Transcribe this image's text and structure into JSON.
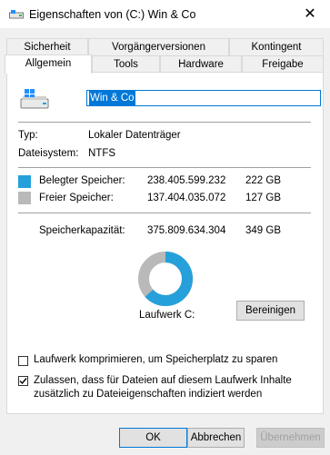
{
  "window": {
    "title": "Eigenschaften von (C:) Win & Co",
    "close_glyph": "✕"
  },
  "tabs_row1": [
    "Sicherheit",
    "Vorgängerversionen",
    "Kontingent"
  ],
  "tabs_row2": [
    "Allgemein",
    "Tools",
    "Hardware",
    "Freigabe"
  ],
  "drive_name": "Win & Co",
  "type_label": "Typ:",
  "type_value": "Lokaler Datenträger",
  "fs_label": "Dateisystem:",
  "fs_value": "NTFS",
  "used": {
    "label": "Belegter Speicher:",
    "bytes": "238.405.599.232",
    "gb": "222 GB",
    "color": "#26a0da"
  },
  "free": {
    "label": "Freier Speicher:",
    "bytes": "137.404.035.072",
    "gb": "127 GB",
    "color": "#b9b9b9"
  },
  "capacity": {
    "label": "Speicherkapazität:",
    "bytes": "375.809.634.304",
    "gb": "349 GB"
  },
  "used_fraction": 0.6344,
  "drive_label": "Laufwerk C:",
  "cleanup_button": "Bereinigen",
  "compress_checkbox": {
    "label": "Laufwerk komprimieren, um Speicherplatz zu sparen",
    "checked": false
  },
  "index_checkbox": {
    "line1": "Zulassen, dass für Dateien auf diesem Laufwerk Inhalte",
    "line2": "zusätzlich zu Dateieigenschaften indiziert werden",
    "checked": true
  },
  "buttons": {
    "ok": "OK",
    "cancel": "Abbrechen",
    "apply": "Übernehmen"
  }
}
